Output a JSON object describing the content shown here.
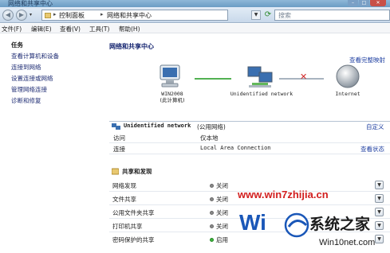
{
  "window": {
    "title": "网络和共享中心"
  },
  "address_bar": {
    "crumbs": [
      "控制面板",
      "网络和共享中心"
    ],
    "search_placeholder": "搜索"
  },
  "menu": {
    "items": [
      "文件(F)",
      "编辑(E)",
      "查看(V)",
      "工具(T)",
      "帮助(H)"
    ]
  },
  "sidebar": {
    "heading": "任务",
    "links": [
      "查看计算机和设备",
      "连接到网络",
      "设置连接或网络",
      "管理网络连接",
      "诊断和修复"
    ]
  },
  "main": {
    "title": "网络和共享中心",
    "view_full_map": "查看完整映射",
    "map": {
      "computer_name": "WIN2008",
      "computer_sub": "(此计算机)",
      "network_label": "Unidentified network",
      "internet_label": "Internet"
    },
    "network": {
      "name": "Unidentified network",
      "type": "(公用网络)",
      "customize": "自定义",
      "rows": [
        {
          "label": "访问",
          "value": "仅本地"
        },
        {
          "label": "连接",
          "value": "Local Area Connection",
          "action": "查看状态"
        }
      ]
    },
    "sharing": {
      "heading": "共享和发现",
      "rows": [
        {
          "label": "网络发现",
          "value": "关闭",
          "on": false
        },
        {
          "label": "文件共享",
          "value": "关闭",
          "on": false
        },
        {
          "label": "公用文件夹共享",
          "value": "关闭",
          "on": false
        },
        {
          "label": "打印机共享",
          "value": "关闭",
          "on": false
        },
        {
          "label": "密码保护的共享",
          "value": "启用",
          "on": true
        }
      ]
    }
  },
  "watermark": {
    "url": "www.win7zhijia.cn",
    "brand_partial": "Wi",
    "brand_cn": "系统之家",
    "brand_url": "Win10net.com"
  },
  "colors": {
    "link": "#1d2b73",
    "status_on": "#3cb43c",
    "status_off": "#8a8a8a",
    "watermark_red": "#d21e1e",
    "connected_line": "#52b152",
    "broken_x": "#d22a2a"
  }
}
